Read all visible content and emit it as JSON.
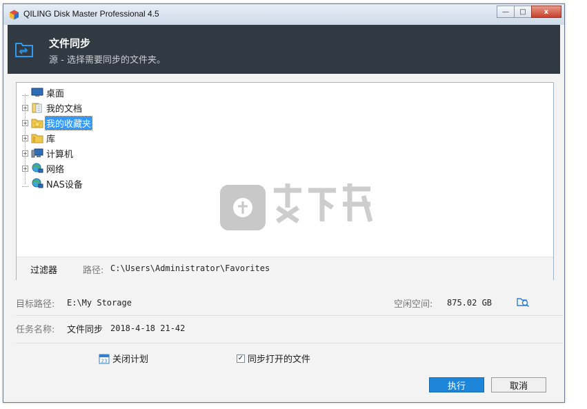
{
  "window": {
    "title": "QILING Disk Master Professional 4.5",
    "controls": {
      "minimize": "—",
      "maximize": "□",
      "close": "x"
    }
  },
  "header": {
    "title": "文件同步",
    "subtitle": "源 - 选择需要同步的文件夹。"
  },
  "tree": {
    "items": [
      {
        "label": "桌面",
        "icon": "desktop-icon",
        "expandable": false,
        "expander": ""
      },
      {
        "label": "我的文档",
        "icon": "documents-icon",
        "expandable": true,
        "expander": "+"
      },
      {
        "label": "我的收藏夹",
        "icon": "favorites-folder-icon",
        "expandable": true,
        "expander": "+",
        "selected": true
      },
      {
        "label": "库",
        "icon": "library-folder-icon",
        "expandable": true,
        "expander": "+"
      },
      {
        "label": "计算机",
        "icon": "computer-icon",
        "expandable": true,
        "expander": "+"
      },
      {
        "label": "网络",
        "icon": "network-icon",
        "expandable": true,
        "expander": "+"
      },
      {
        "label": "NAS设备",
        "icon": "nas-icon",
        "expandable": false,
        "expander": ""
      }
    ]
  },
  "filter": {
    "button_label": "过滤器",
    "path_label": "路径:",
    "path_value": "C:\\Users\\Administrator\\Favorites"
  },
  "target": {
    "label": "目标路径:",
    "value": "E:\\My Storage",
    "free_label": "空闲空间:",
    "free_value": "875.02 GB"
  },
  "task": {
    "label": "任务名称:",
    "value_name": "文件同步",
    "value_date": "2018-4-18 21-42"
  },
  "options": {
    "schedule_label": "关闭计划",
    "sync_open_label": "同步打开的文件",
    "sync_open_checked": "✓"
  },
  "buttons": {
    "execute": "执行",
    "cancel": "取消"
  },
  "colors": {
    "header_bg": "#313a43",
    "accent": "#1e86d8",
    "selection": "#3399ff"
  }
}
